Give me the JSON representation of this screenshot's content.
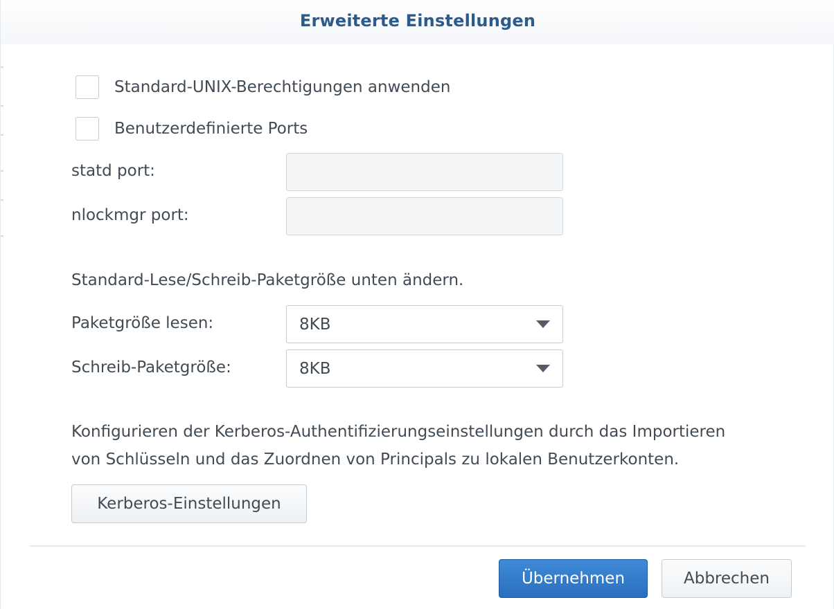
{
  "dialog": {
    "title": "Erweiterte Einstellungen"
  },
  "options": {
    "unix_permissions_label": "Standard-UNIX-Berechtigungen anwenden",
    "unix_permissions_checked": false,
    "custom_ports_label": "Benutzerdefinierte Ports",
    "custom_ports_checked": false
  },
  "ports": {
    "statd_label": "statd port:",
    "statd_value": "",
    "nlockmgr_label": "nlockmgr port:",
    "nlockmgr_value": ""
  },
  "packet": {
    "intro": "Standard-Lese/Schreib-Paketgröße unten ändern.",
    "read_label": "Paketgröße lesen:",
    "read_value": "8KB",
    "write_label": "Schreib-Paketgröße:",
    "write_value": "8KB"
  },
  "kerberos": {
    "description_line1": "Konfigurieren der Kerberos-Authentifizierungseinstellungen durch das Importieren",
    "description_line2": "von Schlüsseln und das Zuordnen von Principals zu lokalen Benutzerkonten.",
    "button_label": "Kerberos-Einstellungen"
  },
  "footer": {
    "apply_label": "Übernehmen",
    "cancel_label": "Abbrechen"
  },
  "colors": {
    "title": "#2b5b8c",
    "primary_button": "#2a6fbd",
    "text": "#414b55"
  },
  "icons": {
    "dropdown": "chevron-down-icon"
  }
}
